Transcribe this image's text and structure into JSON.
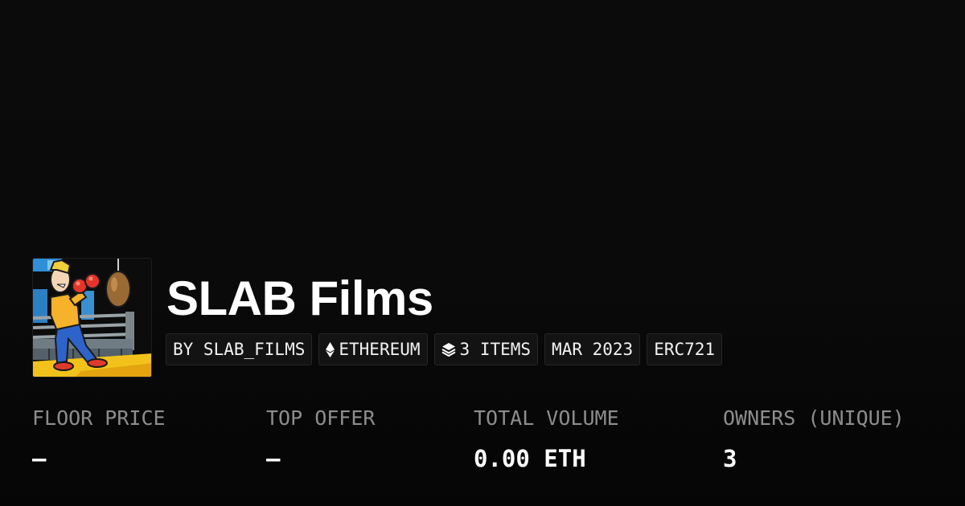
{
  "collection": {
    "name": "SLAB Films",
    "avatar_alt": "cartoon boxer with punching bag"
  },
  "chips": {
    "creator": "BY SLAB_FILMS",
    "chain": "ETHEREUM",
    "chain_icon": "ethereum-icon",
    "items": "3 ITEMS",
    "items_icon": "layers-icon",
    "date": "MAR 2023",
    "standard": "ERC721"
  },
  "stats": {
    "floor_price": {
      "label": "FLOOR PRICE",
      "value": "–"
    },
    "top_offer": {
      "label": "TOP OFFER",
      "value": "–"
    },
    "total_volume": {
      "label": "TOTAL VOLUME",
      "value": "0.00 ETH"
    },
    "owners": {
      "label": "OWNERS (UNIQUE)",
      "value": "3"
    }
  }
}
